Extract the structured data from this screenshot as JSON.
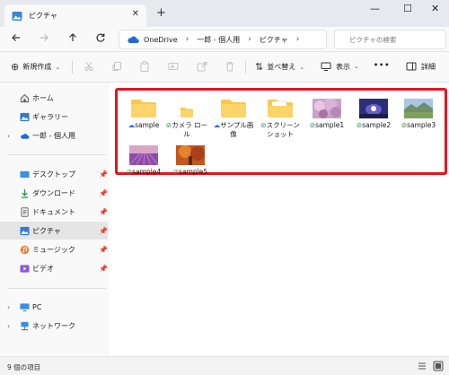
{
  "window": {
    "tab_title": "ピクチャ",
    "tab_close": "✕",
    "new_tab": "+",
    "controls": {
      "minimize": "—",
      "maximize": "☐",
      "close": "✕"
    }
  },
  "nav": {
    "back_icon": "arrow-left",
    "forward_icon": "arrow-right",
    "up_icon": "arrow-up",
    "refresh_icon": "refresh",
    "breadcrumbs": [
      "OneDrive",
      "一郎 - 個人用",
      "ピクチャ"
    ],
    "search_placeholder": "ピクチャの検索"
  },
  "commandbar": {
    "new_label": "新規作成",
    "sort_label": "並べ替え",
    "view_label": "表示",
    "more_label": "•••",
    "details_label": "詳細"
  },
  "sidebar": {
    "items": [
      {
        "label": "ホーム",
        "icon": "home-icon"
      },
      {
        "label": "ギャラリー",
        "icon": "gallery-icon"
      },
      {
        "label": "一郎 - 個人用",
        "icon": "cloud-icon"
      },
      {
        "label": "デスクトップ",
        "icon": "desktop-icon"
      },
      {
        "label": "ダウンロード",
        "icon": "download-icon"
      },
      {
        "label": "ドキュメント",
        "icon": "documents-icon"
      },
      {
        "label": "ピクチャ",
        "icon": "pictures-icon"
      },
      {
        "label": "ミュージック",
        "icon": "music-icon"
      },
      {
        "label": "ビデオ",
        "icon": "video-icon"
      },
      {
        "label": "PC",
        "icon": "pc-icon"
      },
      {
        "label": "ネットワーク",
        "icon": "network-icon"
      }
    ]
  },
  "files": [
    {
      "name": "sample",
      "type": "folder",
      "status": "cloud"
    },
    {
      "name": "カメラ ロール",
      "type": "folder-small",
      "status": "synced"
    },
    {
      "name": "サンプル画像",
      "type": "folder",
      "status": "cloud"
    },
    {
      "name": "スクリーンショット",
      "type": "folder-docs",
      "status": "synced"
    },
    {
      "name": "sample1",
      "type": "image-blossom",
      "status": "synced"
    },
    {
      "name": "sample2",
      "type": "image-night",
      "status": "synced"
    },
    {
      "name": "sample3",
      "type": "image-field",
      "status": "synced"
    },
    {
      "name": "sample4",
      "type": "image-lavender",
      "status": "synced"
    },
    {
      "name": "sample5",
      "type": "image-autumn",
      "status": "synced"
    }
  ],
  "status": {
    "item_count": "9 個の項目"
  },
  "colors": {
    "highlight": "#e4151f",
    "folder": "#f8c846",
    "accent": "#2a6fd1",
    "synced": "#1e8a3b"
  }
}
